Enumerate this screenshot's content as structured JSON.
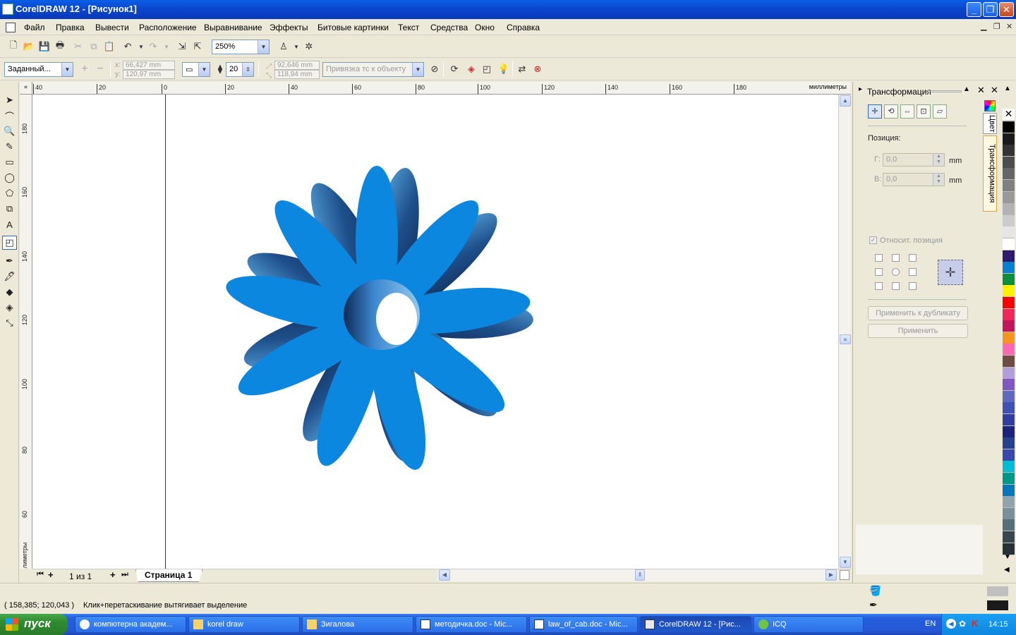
{
  "window": {
    "title": "CorelDRAW 12 - [Рисунок1]",
    "min": "_",
    "max": "❐",
    "close": "✕"
  },
  "menu": [
    "Файл",
    "Правка",
    "Вывести",
    "Расположение",
    "Выравнивание",
    "Эффекты",
    "Битовые картинки",
    "Текст",
    "Средства",
    "Окно",
    "Справка"
  ],
  "toolbar": {
    "zoom": "250%"
  },
  "propbar": {
    "preset": "Заданный...",
    "x_label": "x:",
    "x_value": "66,427 mm",
    "y_label": "y:",
    "y_value": "120,97 mm",
    "depth_value": "20",
    "vp_x": "92,646 mm",
    "vp_y": "118,94 mm",
    "vp_lock": "Привязка тс к объекту"
  },
  "rulers": {
    "h_ticks": [
      "40",
      "20",
      "0",
      "20",
      "40",
      "60",
      "80",
      "100",
      "120",
      "140",
      "160",
      "180"
    ],
    "h_unit": "миллиметры",
    "v_ticks": [
      "180",
      "160",
      "140",
      "120",
      "100",
      "80",
      "60"
    ],
    "v_unit": "миллиметры"
  },
  "page_nav": {
    "count": "1 из 1",
    "tab": "Страница 1"
  },
  "docker": {
    "title": "Трансформация",
    "position_label": "Позиция:",
    "h_label": "Г:",
    "h_value": "0,0",
    "h_unit": "mm",
    "v_label": "В:",
    "v_value": "0,0",
    "v_unit": "mm",
    "relative_label": "Относит. позиция",
    "apply_dup": "Применить к дубликату",
    "apply": "Применить",
    "tab_color": "Цвет",
    "tab_transform": "Трансформация"
  },
  "palette": [
    "#000000",
    "#1a1a1a",
    "#333333",
    "#4d4d4d",
    "#666666",
    "#808080",
    "#999999",
    "#b3b3b3",
    "#cccccc",
    "#e6e6e6",
    "#ffffff",
    "#2e1a6e",
    "#0a7fd1",
    "#0b8f3a",
    "#fff200",
    "#ff0000",
    "#f0285a",
    "#c2185b",
    "#f7941d",
    "#ff69b4",
    "#6d4c41",
    "#b39ddb",
    "#7e57c2",
    "#5c6bc0",
    "#3f51b5",
    "#303f9f",
    "#1a237e",
    "#26418f",
    "#3949ab",
    "#00bcd4",
    "#009688",
    "#0277bd",
    "#90a4ae",
    "#78909c",
    "#546e7a",
    "#37474f",
    "#263238"
  ],
  "status": {
    "coords": "( 158,385; 120,043 )",
    "hint": "Клик+перетаскивание вытягивает выделение"
  },
  "flower": {
    "petal_color": "#0b87e0",
    "extrude_color": "#1e4f8a"
  },
  "taskbar": {
    "start": "пуск",
    "tasks": [
      "компютерна академ...",
      "korel draw",
      "Зигалова",
      "методичка.doc - Mic...",
      "law_of_cab.doc - Mic...",
      "CorelDRAW 12 - [Рис...",
      "ICQ"
    ],
    "lang": "EN",
    "time": "14:15"
  }
}
